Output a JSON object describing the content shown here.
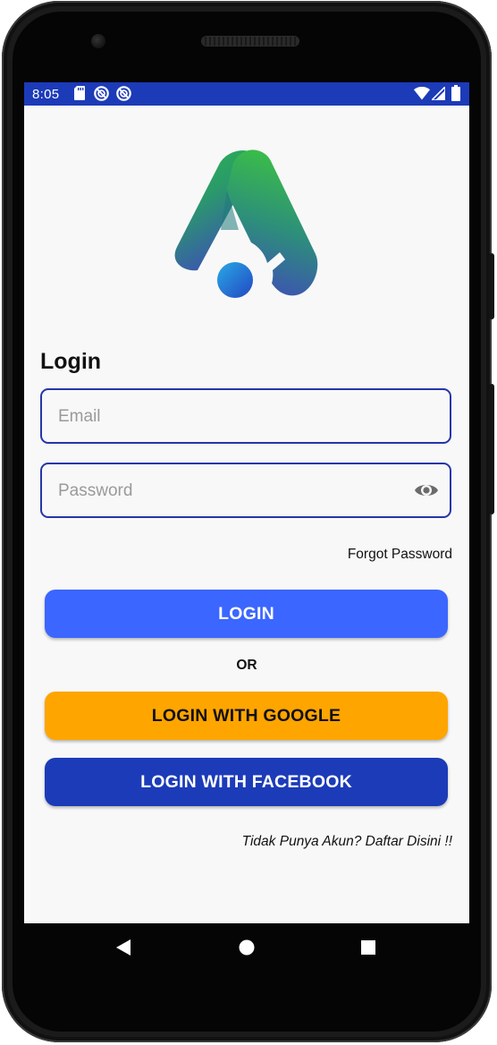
{
  "status_bar": {
    "time": "8:05",
    "icons": [
      "sd-card-icon",
      "sync-off-icon",
      "sync-off-icon",
      "wifi-icon",
      "cell-signal-icon",
      "battery-icon"
    ]
  },
  "app": {
    "logo_icon": "app-logo-icon",
    "title": "Login",
    "email": {
      "placeholder": "Email",
      "value": ""
    },
    "password": {
      "placeholder": "Password",
      "value": "",
      "toggle_icon": "eye-icon"
    },
    "forgot_password": "Forgot Password",
    "login_button": "LOGIN",
    "or_label": "OR",
    "google_button": "LOGIN WITH GOOGLE",
    "facebook_button": "LOGIN WITH FACEBOOK",
    "register_link": "Tidak Punya Akun? Daftar Disini !!"
  },
  "nav_bar": {
    "icons": [
      "back-icon",
      "home-icon",
      "recents-icon"
    ]
  },
  "colors": {
    "primary_dark": "#1c3bb8",
    "login_button": "#3b66ff",
    "google_button": "#ffa500",
    "facebook_button": "#1c3bb8",
    "field_border": "#2536a8",
    "background": "#f8f8f8"
  }
}
